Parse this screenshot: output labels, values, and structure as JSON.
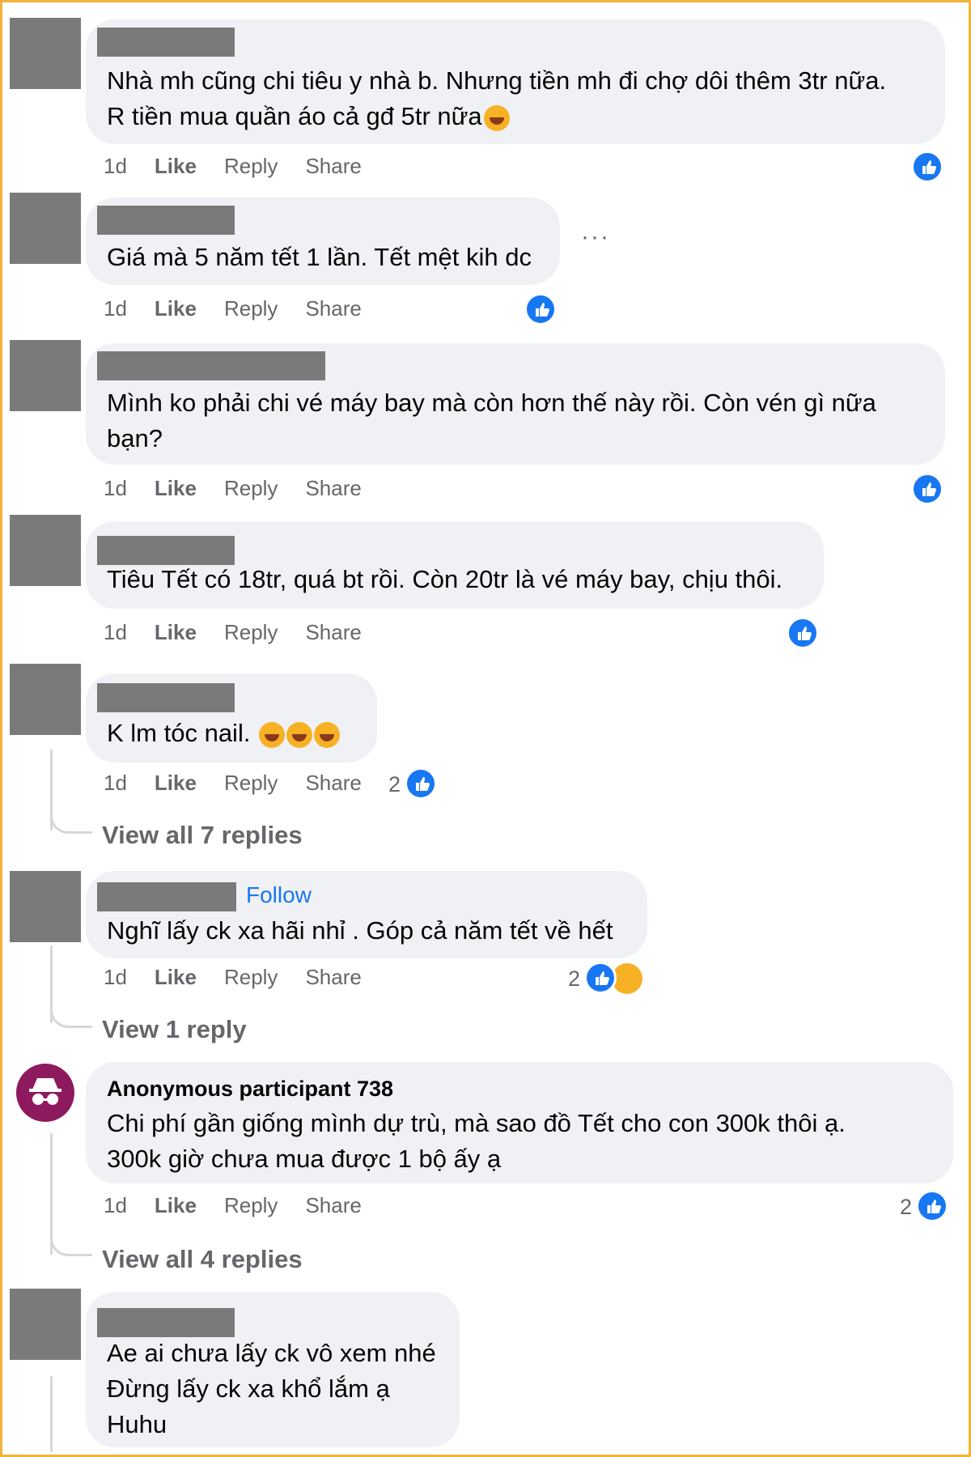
{
  "comments": [
    {
      "text": "Nhà mh cũng chi tiêu y nhà b. Nhưng tiền mh đi chợ dôi thêm 3tr nữa.\nR tiền mua quần áo cả gđ 5tr nữa",
      "time": "1d",
      "like": "Like",
      "reply": "Reply",
      "share": "Share"
    },
    {
      "text": "Giá mà 5 năm tết 1 lần. Tết mệt kih dc",
      "time": "1d",
      "like": "Like",
      "reply": "Reply",
      "share": "Share"
    },
    {
      "text": "Mình ko phải chi vé máy bay mà còn hơn thế này rồi. Còn vén gì nữa\nbạn?",
      "time": "1d",
      "like": "Like",
      "reply": "Reply",
      "share": "Share"
    },
    {
      "text": "Tiêu Tết có 18tr, quá bt rồi. Còn 20tr là vé máy bay, chịu thôi.",
      "time": "1d",
      "like": "Like",
      "reply": "Reply",
      "share": "Share"
    },
    {
      "text": "K lm tóc nail.",
      "time": "1d",
      "like": "Like",
      "reply": "Reply",
      "share": "Share",
      "reaction_count": "2",
      "view_replies": "View all 7 replies"
    },
    {
      "follow": "Follow",
      "text": "Nghĩ lấy ck xa hãi nhỉ . Góp cả năm tết về hết",
      "time": "1d",
      "like": "Like",
      "reply": "Reply",
      "share": "Share",
      "reaction_count": "2",
      "view_replies": "View 1 reply"
    },
    {
      "name": "Anonymous participant 738",
      "text": "Chi phí gần giống mình dự trù, mà sao đồ Tết cho con 300k thôi ạ.\n300k giờ chưa mua được 1 bộ ấy ạ",
      "time": "1d",
      "like": "Like",
      "reply": "Reply",
      "share": "Share",
      "reaction_count": "2",
      "view_replies": "View all 4 replies"
    },
    {
      "text": "Ae ai chưa lấy ck vô xem nhé\nĐừng lấy ck xa khổ lắm ạ\nHuhu"
    }
  ],
  "more_options": "···",
  "colors": {
    "frame": "#f3b33c",
    "bubble": "#eff1f4",
    "like_blue": "#1877f2",
    "link": "#1877f2",
    "muted": "#65676b"
  },
  "icons": {
    "like": "like-reaction-icon",
    "sad": "sad-reaction-icon",
    "anon": "incognito-icon",
    "emoji_laugh": "laughing-emoji-icon"
  }
}
